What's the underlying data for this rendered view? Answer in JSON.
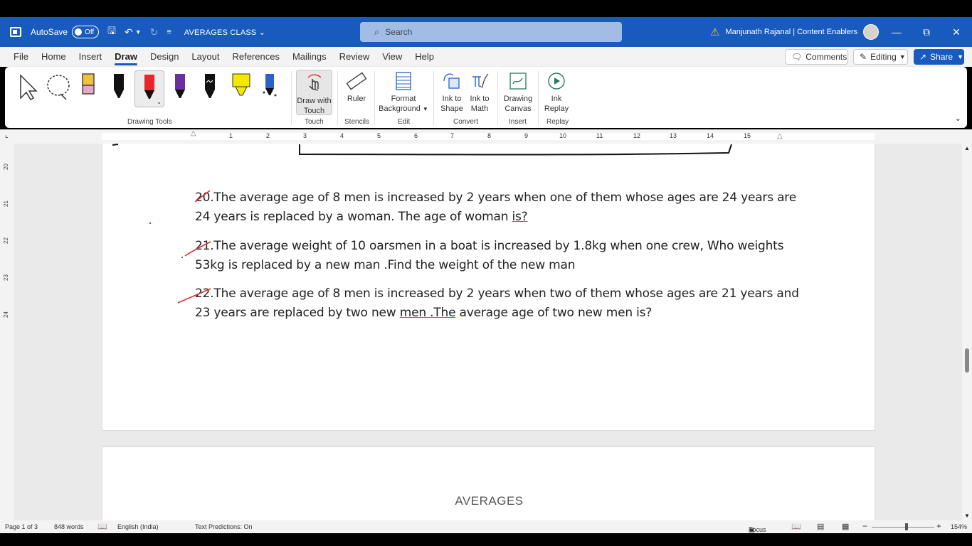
{
  "titlebar": {
    "autosave_label": "AutoSave",
    "autosave_state": "Off",
    "doc_title": "AVERAGES CLASS",
    "search_placeholder": "Search",
    "user_name": "Manjunath Rajanal | Content Enablers"
  },
  "menu": {
    "tabs": [
      "File",
      "Home",
      "Insert",
      "Draw",
      "Design",
      "Layout",
      "References",
      "Mailings",
      "Review",
      "View",
      "Help"
    ],
    "active_tab": "Draw",
    "comments_label": "Comments",
    "editing_label": "Editing",
    "share_label": "Share"
  },
  "ribbon": {
    "groups": {
      "drawing_tools": "Drawing Tools",
      "touch": "Touch",
      "stencils": "Stencils",
      "edit": "Edit",
      "convert": "Convert",
      "insert": "Insert",
      "replay": "Replay"
    },
    "draw_with_touch_line1": "Draw with",
    "draw_with_touch_line2": "Touch",
    "ruler": "Ruler",
    "format_background_line1": "Format",
    "format_background_line2": "Background",
    "ink_to_shape_line1": "Ink to",
    "ink_to_shape_line2": "Shape",
    "ink_to_math_line1": "Ink to",
    "ink_to_math_line2": "Math",
    "drawing_canvas_line1": "Drawing",
    "drawing_canvas_line2": "Canvas",
    "ink_replay_line1": "Ink",
    "ink_replay_line2": "Replay"
  },
  "ruler": {
    "numbers": [
      "1",
      "2",
      "3",
      "4",
      "5",
      "6",
      "7",
      "8",
      "9",
      "10",
      "11",
      "12",
      "13",
      "14",
      "15"
    ],
    "vertical_numbers": [
      "20",
      "21",
      "22",
      "23",
      "24"
    ]
  },
  "document": {
    "q20_line1": "20.The average age of 8 men is increased by 2 years when one of them whose ages are 24 years are",
    "q20_line2_a": "24 years is replaced by a woman. The age of woman ",
    "q20_line2_b": "is?",
    "q21_line1": "21.The average weight of 10 oarsmen in a boat is increased by 1.8kg when one crew, Who weights",
    "q21_line2": "53kg is replaced by a new man .Find the weight of the new man",
    "q22_line1": "22.The average age of 8 men is increased by 2 years when two of them whose ages are 21 years and",
    "q22_line2_a": "23 years are replaced by two new ",
    "q22_line2_b": "men .The",
    "q22_line2_c": " average age of two new men is?",
    "page2_title": "AVERAGES"
  },
  "status": {
    "page": "Page 1 of 3",
    "words": "848 words",
    "language": "English (India)",
    "predictions": "Text Predictions: On",
    "focus": "Focus",
    "zoom": "154%"
  },
  "colors": {
    "brand_blue": "#185abd",
    "ink_red": "#e03030",
    "pen_red": "#e8262b",
    "pen_purple": "#6b2fa0",
    "highlighter_yellow": "#f5e800"
  }
}
